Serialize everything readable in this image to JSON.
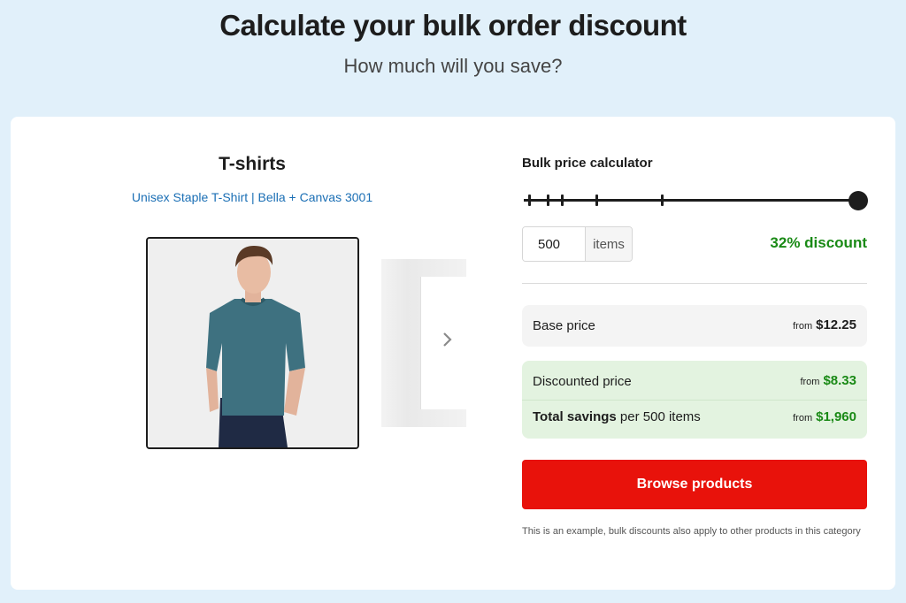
{
  "header": {
    "title": "Calculate your bulk order discount",
    "subtitle": "How much will you save?"
  },
  "product": {
    "category": "T-shirts",
    "name_link": "Unisex Staple T-Shirt | Bella + Canvas 3001",
    "image_alt": "Man wearing teal t-shirt"
  },
  "calculator": {
    "title": "Bulk price calculator",
    "slider": {
      "tick_quantities": [
        "",
        "",
        "",
        "",
        ""
      ],
      "level": 1.0
    },
    "quantity": {
      "value": "500",
      "unit": "items"
    },
    "discount_label": "32% discount",
    "base_price": {
      "label": "Base price",
      "from": "from",
      "amount": "$12.25"
    },
    "discounted_price": {
      "label": "Discounted price",
      "from": "from",
      "amount": "$8.33"
    },
    "total_savings": {
      "label_bold": "Total savings",
      "label_rest": " per 500 items",
      "from": "from",
      "amount": "$1,960"
    },
    "button_label": "Browse products",
    "note": "This is an example, bulk discounts also apply to other products in this category"
  },
  "colors": {
    "background": "#e1f0fa",
    "accent_red": "#e8120b",
    "discount_green": "#1a8a16",
    "link_blue": "#1b6fb5"
  }
}
